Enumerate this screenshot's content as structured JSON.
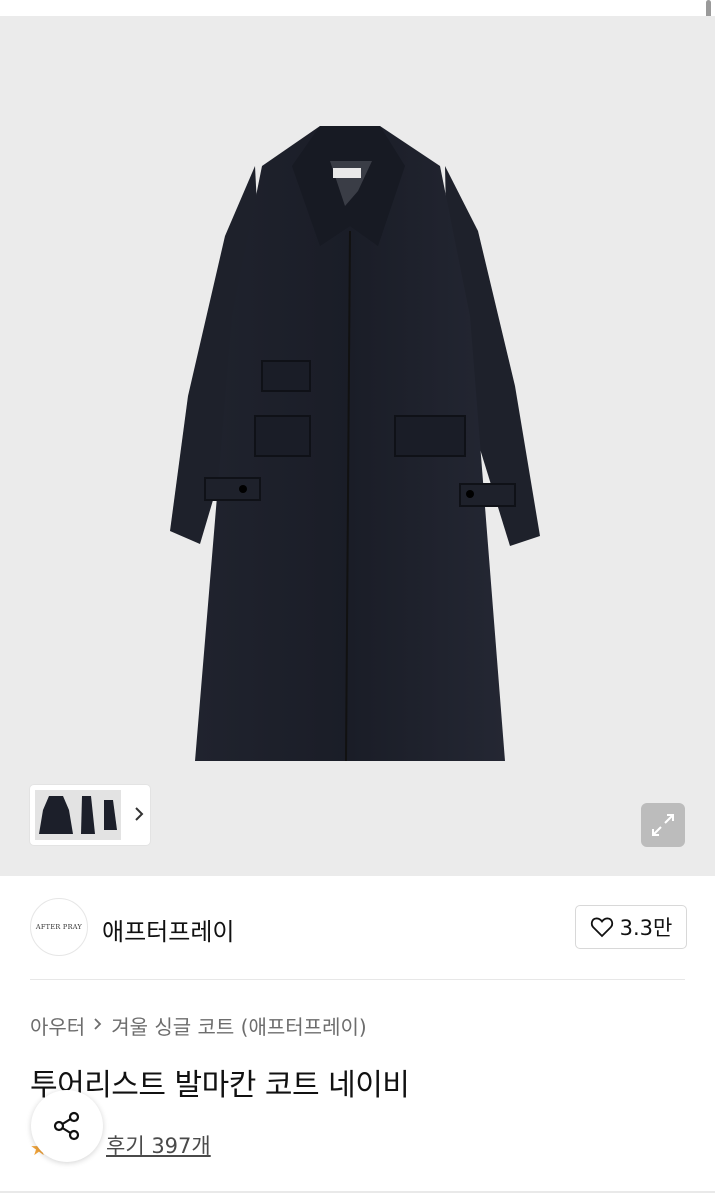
{
  "gallery": {
    "main_image": "navy balmacaan coat product photo",
    "next_icon": "chevron-right-icon",
    "expand_icon": "expand-icon"
  },
  "brand": {
    "logo_text": "AFTER PRAY",
    "name": "애프터프레이",
    "like_count": "3.3만",
    "like_icon": "heart-icon"
  },
  "breadcrumb": {
    "items": [
      "아우터",
      "겨울 싱글 코트 (애프터프레이)"
    ],
    "separator_icon": "chevron-right-icon"
  },
  "product": {
    "title": "투어리스트 발마칸 코트 네이비",
    "review_label": "후기 397개",
    "rating_icon": "star-icon"
  },
  "share": {
    "icon": "share-icon"
  },
  "colors": {
    "hero_bg": "#ebebeb",
    "coat": "#1c1f2a",
    "text": "#111111",
    "muted": "#6d6d6d"
  }
}
